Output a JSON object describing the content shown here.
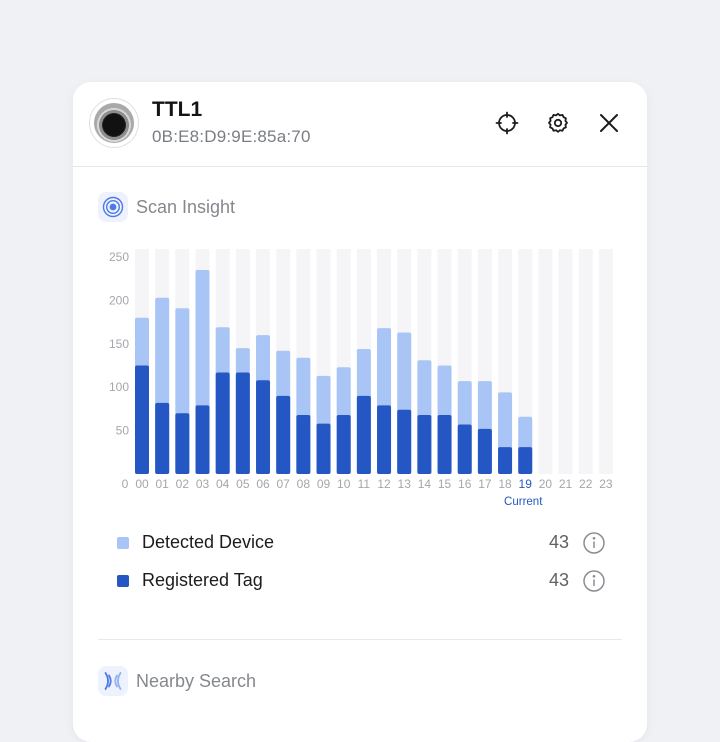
{
  "device": {
    "title": "TTL1",
    "address": "0B:E8:D9:9E:85a:70"
  },
  "header_icons": [
    "crosshair-icon",
    "gear-icon",
    "close-icon"
  ],
  "scan_insight": {
    "label": "Scan Insight",
    "icon": "scan-target-icon"
  },
  "colors": {
    "detected": "#a9c5f5",
    "registered": "#2557c4",
    "track": "#f5f5f7",
    "current_label": "#2557c4",
    "tick": "#a3a6ab"
  },
  "chart_data": {
    "type": "bar",
    "stacked": true,
    "categories": [
      "00",
      "01",
      "02",
      "03",
      "04",
      "05",
      "06",
      "07",
      "08",
      "09",
      "10",
      "11",
      "12",
      "13",
      "14",
      "15",
      "16",
      "17",
      "18",
      "19",
      "20",
      "21",
      "22",
      "23"
    ],
    "series": [
      {
        "name": "Registered Tag",
        "values": [
          125,
          82,
          70,
          79,
          117,
          117,
          108,
          90,
          68,
          58,
          68,
          90,
          79,
          74,
          68,
          68,
          57,
          52,
          31,
          31,
          null,
          null,
          null,
          null
        ]
      },
      {
        "name": "Detected Device",
        "values": [
          180,
          203,
          191,
          235,
          169,
          145,
          160,
          142,
          134,
          113,
          123,
          144,
          168,
          163,
          131,
          125,
          107,
          107,
          94,
          66,
          null,
          null,
          null,
          null
        ]
      }
    ],
    "y_ticks": [
      "0",
      "50",
      "100",
      "150",
      "200",
      "250"
    ],
    "ylim": [
      0,
      250
    ],
    "current_index": 19,
    "current_label": "Current",
    "grid": false
  },
  "legend": [
    {
      "label": "Detected Device",
      "value": "43",
      "color_key": "detected"
    },
    {
      "label": "Registered Tag",
      "value": "43",
      "color_key": "registered"
    }
  ],
  "nearby_search": {
    "label": "Nearby Search",
    "icon": "nearby-signal-icon"
  }
}
